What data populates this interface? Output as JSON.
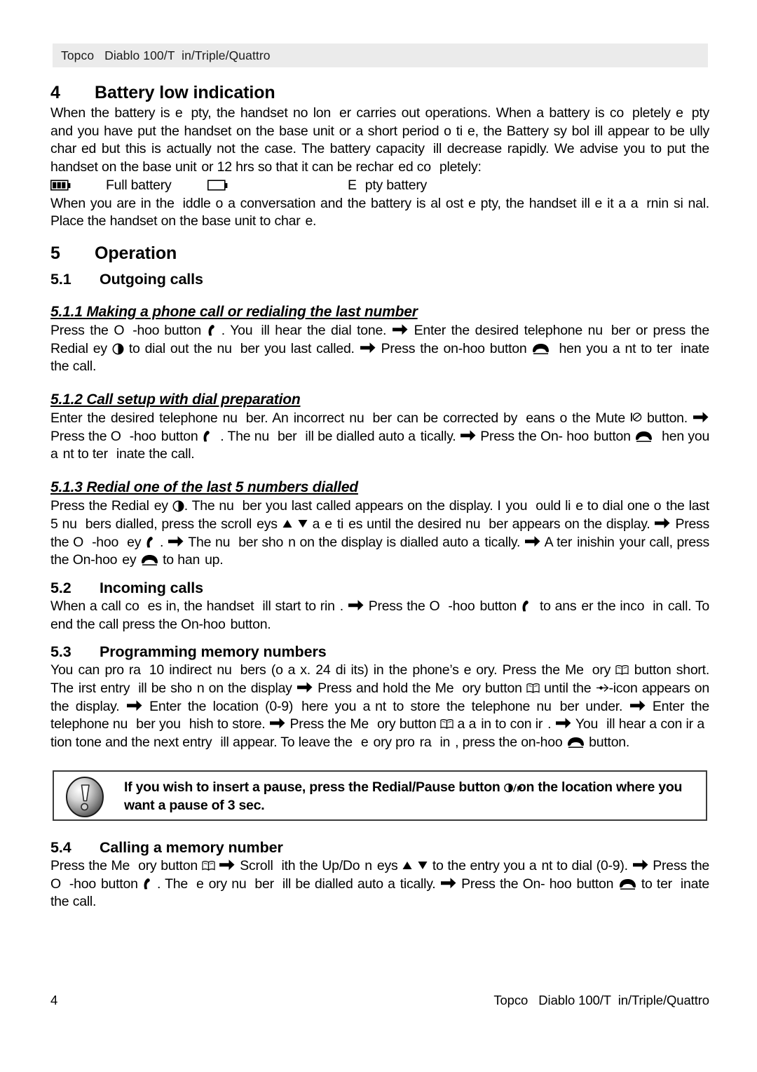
{
  "header": {
    "title": "Topco   Diablo 100/T  in/Triple/Quattro"
  },
  "sections": {
    "s4": {
      "number": "4",
      "title": "Battery low indication",
      "para1_line1": "When the battery is e",
      "para1_line1b": "pty, the handset no lon",
      "para1_line1c": "er carries out operations. When a battery is co",
      "para1_line1d": "pletely",
      "para1_line2a": "e",
      "para1_line2b": "pty and you have put the handset on the base unit",
      "para1_line2c": "or a short period o",
      "para1_line2d": "ti",
      "para1_line2e": "e, the Battery sy",
      "para1_line2f": "bol",
      "para1_line2g": "ill",
      "para1_line3a": "appear to be",
      "para1_line3b": "ully char",
      "para1_line3c": "ed but this is actually not the case. The battery capacity",
      "para1_line3d": "ill decrease rapidly.",
      "para1_line4a": "We advise you to put the handset on the base unit",
      "para1_line4b": "or 12 hrs so that it can be rechar",
      "para1_line4c": "ed co",
      "para1_line4d": "pletely:",
      "battery_full_label": "Full battery",
      "battery_empty_label_a": "E",
      "battery_empty_label_b": "pty battery",
      "para2_line1a": "When you are in the",
      "para2_line1b": "iddle o",
      "para2_line1c": "a conversation and the battery is al",
      "para2_line1d": "ost e",
      "para2_line1e": "pty, the handset",
      "para2_line1f": "ill e",
      "para2_line1g": "it a",
      "para2_line2a": "a",
      "para2_line2b": "rnin",
      "para2_line2c": "si",
      "para2_line2d": "nal. Place the handset on the base unit to char",
      "para2_line2e": "e."
    },
    "s5": {
      "number": "5",
      "title": "Operation"
    },
    "s51": {
      "number": "5.1",
      "title": "Outgoing calls"
    },
    "s511": {
      "title": "5.1.1 Making a phone call or redialing the last number",
      "t1": "Press the O",
      "t2": "-hoo",
      "t3": "button",
      "t4": ". You",
      "t5": "ill hear the dial tone.",
      "t6": "Enter the desired telephone nu",
      "t7": "ber or",
      "t8": "press the Redial",
      "t9": "ey",
      "t10": "to dial out the nu",
      "t11": "ber you last called.",
      "t12": "Press the on-hoo",
      "t13": "button",
      "t14": "hen",
      "t15": "you a",
      "t16": "nt to ter",
      "t17": "inate the call."
    },
    "s512": {
      "title": "5.1.2 Call setup with dial preparation",
      "t1": "Enter the desired telephone nu",
      "t2": "ber. An incorrect nu",
      "t3": "ber can be corrected by",
      "t4": "eans o",
      "t5": "the Mute",
      "t6": "button.",
      "t7": "Press the O",
      "t8": "-hoo",
      "t9": "button",
      "t10": ". The nu",
      "t11": "ber",
      "t12": "ill be dialled auto a",
      "t13": "tically.",
      "t14": "Press the On-",
      "t15": "hoo",
      "t16": "button",
      "t17": "hen you a",
      "t18": "nt to ter",
      "t19": "inate the call."
    },
    "s513": {
      "title": "5.1.3 Redial one of the last 5 numbers dialled",
      "t1": "Press the Redial",
      "t2": "ey",
      "t3": ". The nu",
      "t4": "ber you last called appears on the display. I",
      "t5": "you",
      "t6": "ould li",
      "t7": "e to dial one",
      "t8": "o",
      "t9": "the last 5 nu",
      "t10": "bers dialled, press the scroll",
      "t11": "eys",
      "t12": "a",
      "t13": "e",
      "t14": "ti",
      "t15": "es until the desired nu",
      "t16": "ber appears",
      "t17": "on the display.",
      "t18": "Press the O",
      "t19": "-hoo",
      "t20": "ey",
      "t21": ".",
      "t22": "The nu",
      "t23": "ber sho",
      "t24": "n on the display is dialled",
      "t25": "auto a",
      "t26": "tically.",
      "t27": "A ter",
      "t28": "inishin",
      "t29": "your call, press the On-hoo",
      "t30": "ey",
      "t31": "to han",
      "t32": "up."
    },
    "s52": {
      "number": "5.2",
      "title": "Incoming calls",
      "t1": "When a call co",
      "t2": "es in, the handset",
      "t3": "ill start to rin",
      "t4": ".",
      "t5": "Press the O",
      "t6": "-hoo",
      "t7": "button",
      "t8": "to ans",
      "t9": "er the",
      "t10": "inco",
      "t11": "in",
      "t12": "call. To end the call press  the On-hoo",
      "t13": "button."
    },
    "s53": {
      "number": "5.3",
      "title": "Programming memory numbers",
      "t1": "You can pro",
      "t2": "ra",
      "t3": "10 indirect nu",
      "t4": "bers (o",
      "t5": "a",
      "t6": "x. 24 di",
      "t7": "its) in the phone’s",
      "t8": "e",
      "t9": "ory.",
      "t10": "Press the Me",
      "t11": "ory",
      "t12": "button short.  The",
      "t13": "irst entry",
      "t14": "ill be sho",
      "t15": "n on the display",
      "t16": "Press and hold the",
      "t17": "Me",
      "t18": "ory button",
      "t19": "until the",
      "t20": "-icon appears on the display.",
      "t21": "Enter the location (0-9)",
      "t22": "here you a",
      "t23": "nt",
      "t24": "to store the telephone nu",
      "t25": "ber under.",
      "t26": "Enter the telephone nu",
      "t27": "ber you",
      "t28": "hish to store.",
      "t29": "Press",
      "t30": "the Me",
      "t31": "ory button",
      "t32": "a a",
      "t33": "in to con ir",
      "t34": ".",
      "t35": "You",
      "t36": "ill hear a con ir a",
      "t37": "tion tone and the next entry",
      "t38": "ill",
      "t39": "appear. To leave the",
      "t40": "e",
      "t41": "ory pro",
      "t42": "ra",
      "t43": "in",
      "t44": ", press the on-hoo",
      "t45": "button."
    },
    "note": {
      "line1a": "If you wish to insert a pause, press the Redial/Pause button",
      "line1b": "on the location where",
      "line2": "you want a pause of 3 sec."
    },
    "s54": {
      "number": "5.4",
      "title": "Calling a memory number",
      "t1": "Press the Me",
      "t2": "ory button",
      "t3": "Scroll",
      "t4": "ith the Up/Do",
      "t5": "n",
      "t6": "eys",
      "t7": "to the entry you a",
      "t8": "nt to dial (0-9).",
      "t9": "Press the O",
      "t10": "-hoo",
      "t11": "button",
      "t12": ". The",
      "t13": "e",
      "t14": "ory nu",
      "t15": "ber",
      "t16": "ill be dialled auto a",
      "t17": "tically.",
      "t18": "Press the On-",
      "t19": "hoo",
      "t20": "button",
      "t21": "to ter",
      "t22": "inate the call."
    }
  },
  "footer": {
    "page_number": "4",
    "title": "Topco   Diablo 100/T  in/Triple/Quattro"
  },
  "colors": {
    "header_band": "#ebebeb",
    "text": "#000000",
    "note_border": "#3b3b3b"
  },
  "icons": {
    "battery_full": "battery-full-icon",
    "battery_empty": "battery-empty-icon",
    "off_hook": "off-hook-handset-icon",
    "on_hook": "on-hook-handset-icon",
    "redial": "redial-key-icon",
    "redial_pause": "redial-pause-key-icon",
    "memory": "memory-book-icon",
    "mute": "mute-icon",
    "pointer": "display-pointer-icon",
    "arrow": "right-arrow-icon",
    "scroll_up": "triangle-up-icon",
    "scroll_down": "triangle-down-icon",
    "note": "exclamation-note-icon"
  }
}
